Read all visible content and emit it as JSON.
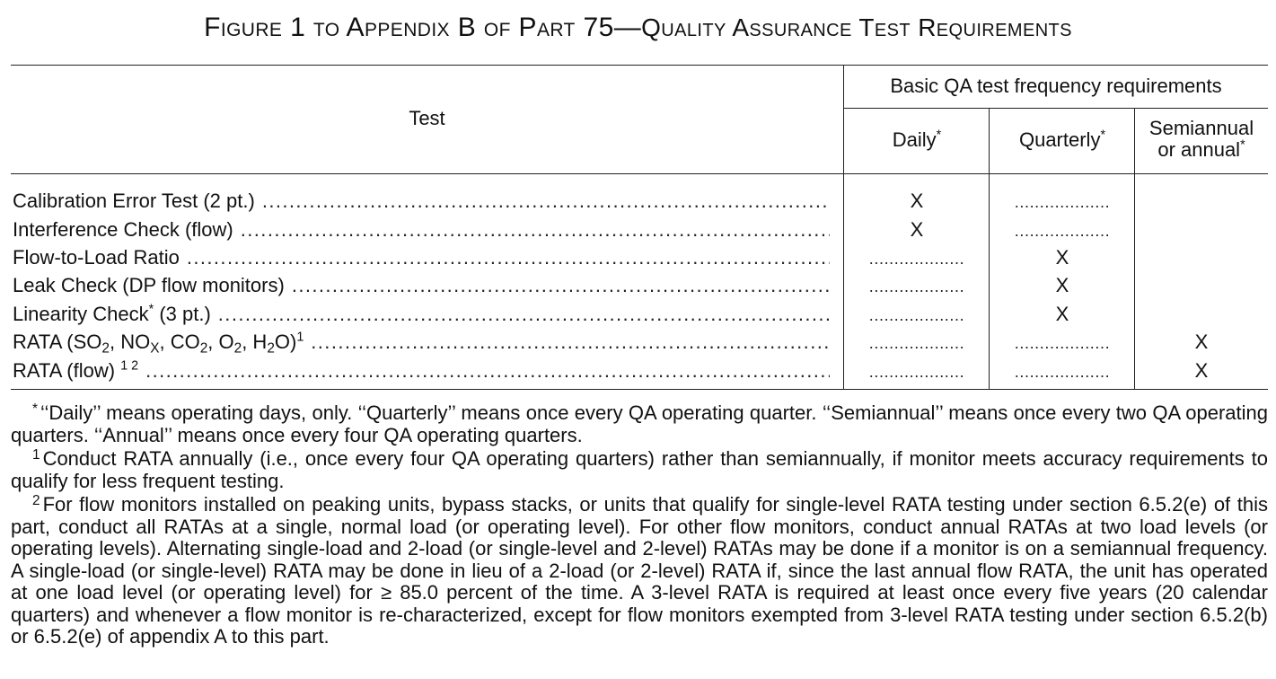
{
  "title": {
    "figure_label": "Figure 1 to Appendix B of Part 75",
    "dash": "—",
    "title_text": "Quality Assurance Test Requirements"
  },
  "table": {
    "header": {
      "test": "Test",
      "group": "Basic QA test frequency requirements",
      "daily": "Daily",
      "quarterly": "Quarterly",
      "semiannual_line1": "Semiannual",
      "semiannual_line2": "or annual",
      "star": "*"
    },
    "rows": [
      {
        "label": "Calibration Error Test (2 pt.)",
        "daily": "X",
        "quarterly": "...................",
        "semiannual": ""
      },
      {
        "label": "Interference Check (flow)",
        "daily": "X",
        "quarterly": "...................",
        "semiannual": ""
      },
      {
        "label": "Flow-to-Load Ratio",
        "daily": "...................",
        "quarterly": "X",
        "semiannual": ""
      },
      {
        "label": "Leak Check (DP flow monitors)",
        "daily": "...................",
        "quarterly": "X",
        "semiannual": ""
      },
      {
        "label_a": "Linearity Check",
        "label_star": "*",
        "label_b": " (3 pt.)",
        "daily": "...................",
        "quarterly": "X",
        "semiannual": ""
      },
      {
        "label_a": "RATA (SO",
        "label_b": ", NO",
        "label_c": ", CO",
        "label_d": ", O",
        "label_e": ", H",
        "label_f": "O)",
        "sub2": "2",
        "subX": "X",
        "note": "1",
        "daily": "...................",
        "quarterly": "...................",
        "semiannual": "X"
      },
      {
        "label": "RATA (flow)",
        "notes": "1 2",
        "daily": "...................",
        "quarterly": "...................",
        "semiannual": "X"
      }
    ],
    "leader": "...................................................................................................................................................................................."
  },
  "footnotes": {
    "star_mark": "*",
    "star_text": "‘‘Daily’’ means operating days, only. ‘‘Quarterly’’ means once every QA operating quarter. ‘‘Semiannual’’ means once every two QA operating quarters. ‘‘Annual’’ means once every four QA operating quarters.",
    "one_mark": "1",
    "one_text": "Conduct RATA annually (i.e., once every four QA operating quarters) rather than semiannually, if monitor meets accuracy requirements to qualify for less frequent testing.",
    "two_mark": "2",
    "two_text": "For flow monitors installed on peaking units, bypass stacks, or units that qualify for single-level RATA testing under section 6.5.2(e) of this part, conduct all RATAs at a single, normal load (or operating level). For other flow monitors, conduct annual RATAs at two load levels (or operating levels). Alternating single-load and 2-load (or single-level and 2-level) RATAs may be done if a monitor is on a semiannual frequency. A single-load (or single-level) RATA may be done in lieu of a 2-load (or 2-level) RATA if, since the last annual flow RATA, the unit has operated at one load level (or operating level) for ≥ 85.0 percent of the time. A 3-level RATA is required at least once every five years (20 calendar quarters) and whenever a flow monitor is re-characterized, except for flow monitors exempted from 3-level RATA testing under section 6.5.2(b) or 6.5.2(e) of appendix A to this part."
  }
}
